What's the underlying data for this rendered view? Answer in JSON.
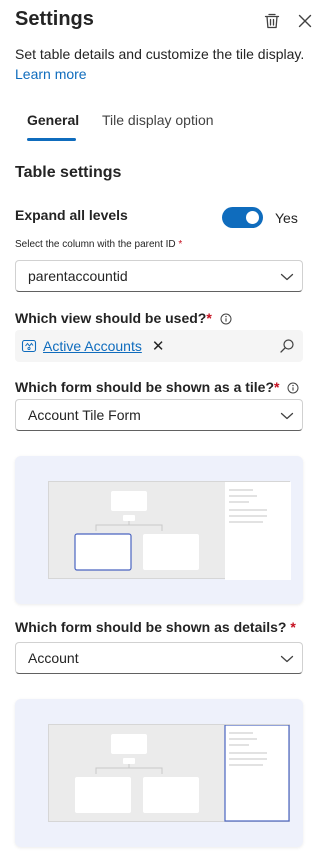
{
  "header": {
    "title": "Settings",
    "delete_icon": "trash-icon",
    "close_icon": "close-icon"
  },
  "description": {
    "text": "Set table details and customize the tile display.",
    "link": "Learn more"
  },
  "tabs": [
    {
      "label": "General",
      "selected": true
    },
    {
      "label": "Tile display option",
      "selected": false
    }
  ],
  "table_settings": {
    "title": "Table settings",
    "expand_all": {
      "label": "Expand all levels",
      "value": "Yes",
      "on": true
    },
    "parent_column": {
      "label": "Select the column with the parent ID",
      "required_mark": "*",
      "value": "parentaccountid"
    },
    "view": {
      "label": "Which view should be used?",
      "required_mark": "*",
      "tag": "Active Accounts"
    },
    "tile_form": {
      "label": "Which form should be shown as a tile?",
      "required_mark": "*",
      "value": "Account Tile Form"
    },
    "details_form": {
      "label": "Which form should be shown as details?",
      "required_mark": "*",
      "value": "Account"
    }
  },
  "colors": {
    "accent": "#0f6cbd",
    "required": "#c50f1f",
    "preview_bg": "#eef1fb"
  }
}
